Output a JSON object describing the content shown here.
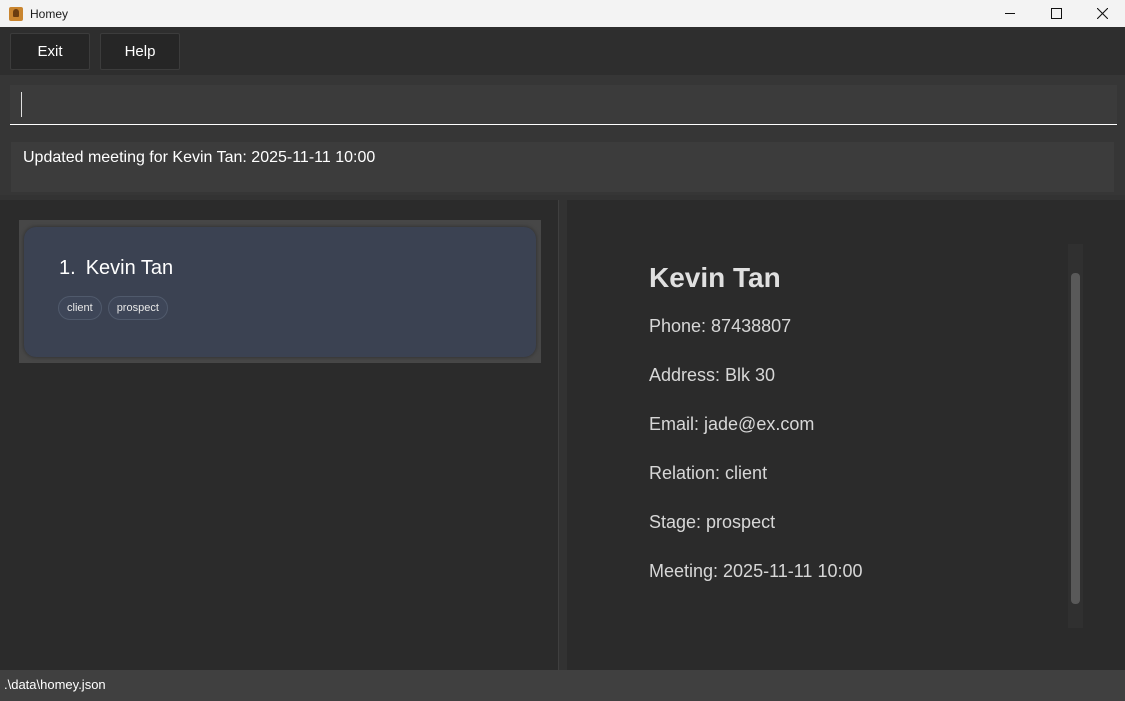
{
  "window": {
    "title": "Homey",
    "icon": "app-icon",
    "controls": [
      "minimize-icon",
      "maximize-icon",
      "close-icon"
    ]
  },
  "menu": {
    "exit_label": "Exit",
    "help_label": "Help"
  },
  "command": {
    "value": "",
    "placeholder": ""
  },
  "result": {
    "message": "Updated meeting for Kevin Tan: 2025-11-11 10:00"
  },
  "person_list": [
    {
      "index": "1.",
      "name": "Kevin Tan",
      "tags": [
        "client",
        "prospect"
      ]
    }
  ],
  "detail": {
    "name": "Kevin Tan",
    "phone": "Phone: 87438807",
    "address": "Address: Blk 30",
    "email": "Email: jade@ex.com",
    "relation": "Relation: client",
    "stage": "Stage: prospect",
    "meeting": "Meeting: 2025-11-11 10:00"
  },
  "status": {
    "file_path": ".\\data\\homey.json"
  },
  "colors": {
    "background": "#2b2b2b",
    "card": "#3b4252",
    "statusbar": "#404040"
  }
}
